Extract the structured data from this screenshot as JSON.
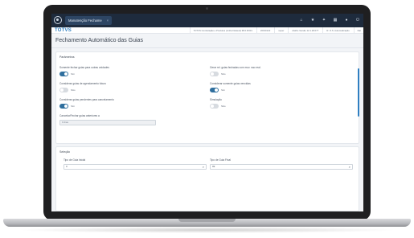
{
  "window": {
    "tab_label": "Manutenção Fechame",
    "tab_close": "×"
  },
  "topbar_icons": [
    "home-icon",
    "star-icon",
    "settings-icon",
    "grid-icon",
    "user-icon",
    "power-icon"
  ],
  "infobar": {
    "brand": "TOTVS",
    "items": [
      "TOTVS Contratação e Produtos (Linha Datasul) 98.0.RX01",
      "20190122",
      "super",
      "Atalho Versão 12.1.28.077",
      "R. O.S. Automatização",
      "Dat"
    ]
  },
  "page": {
    "title": "Fechamento Automático das Guias"
  },
  "parametros": {
    "title": "Parâmetros",
    "fields": [
      {
        "label": "Somente fechar guias para outras unidades",
        "toggle": "Sim",
        "on": true
      },
      {
        "label": "Considerar guias de agendamento futuro",
        "toggle": "Não",
        "on": false
      },
      {
        "label": "Considerar guias pendentes para cancelamento",
        "toggle": "Sim",
        "on": true
      },
      {
        "label": "Gerar rel. guias fechadas com mov. nao real.",
        "toggle": "Não",
        "on": false
      },
      {
        "label": "Considerar somente guias vencidas",
        "toggle": "Sim",
        "on": true
      },
      {
        "label": "Simulação",
        "toggle": "Não",
        "on": false
      }
    ],
    "cancel_label": "Cancelar/Fechar guias anteriores a",
    "cancel_value": "0 dias"
  },
  "selecao": {
    "title": "Seleção",
    "tipo_inicial_label": "Tipo de Guia Inicial",
    "tipo_inicial_value": "0",
    "tipo_final_label": "Tipo de Guia Final",
    "tipo_final_value": "99",
    "search_icon": "search-icon"
  }
}
